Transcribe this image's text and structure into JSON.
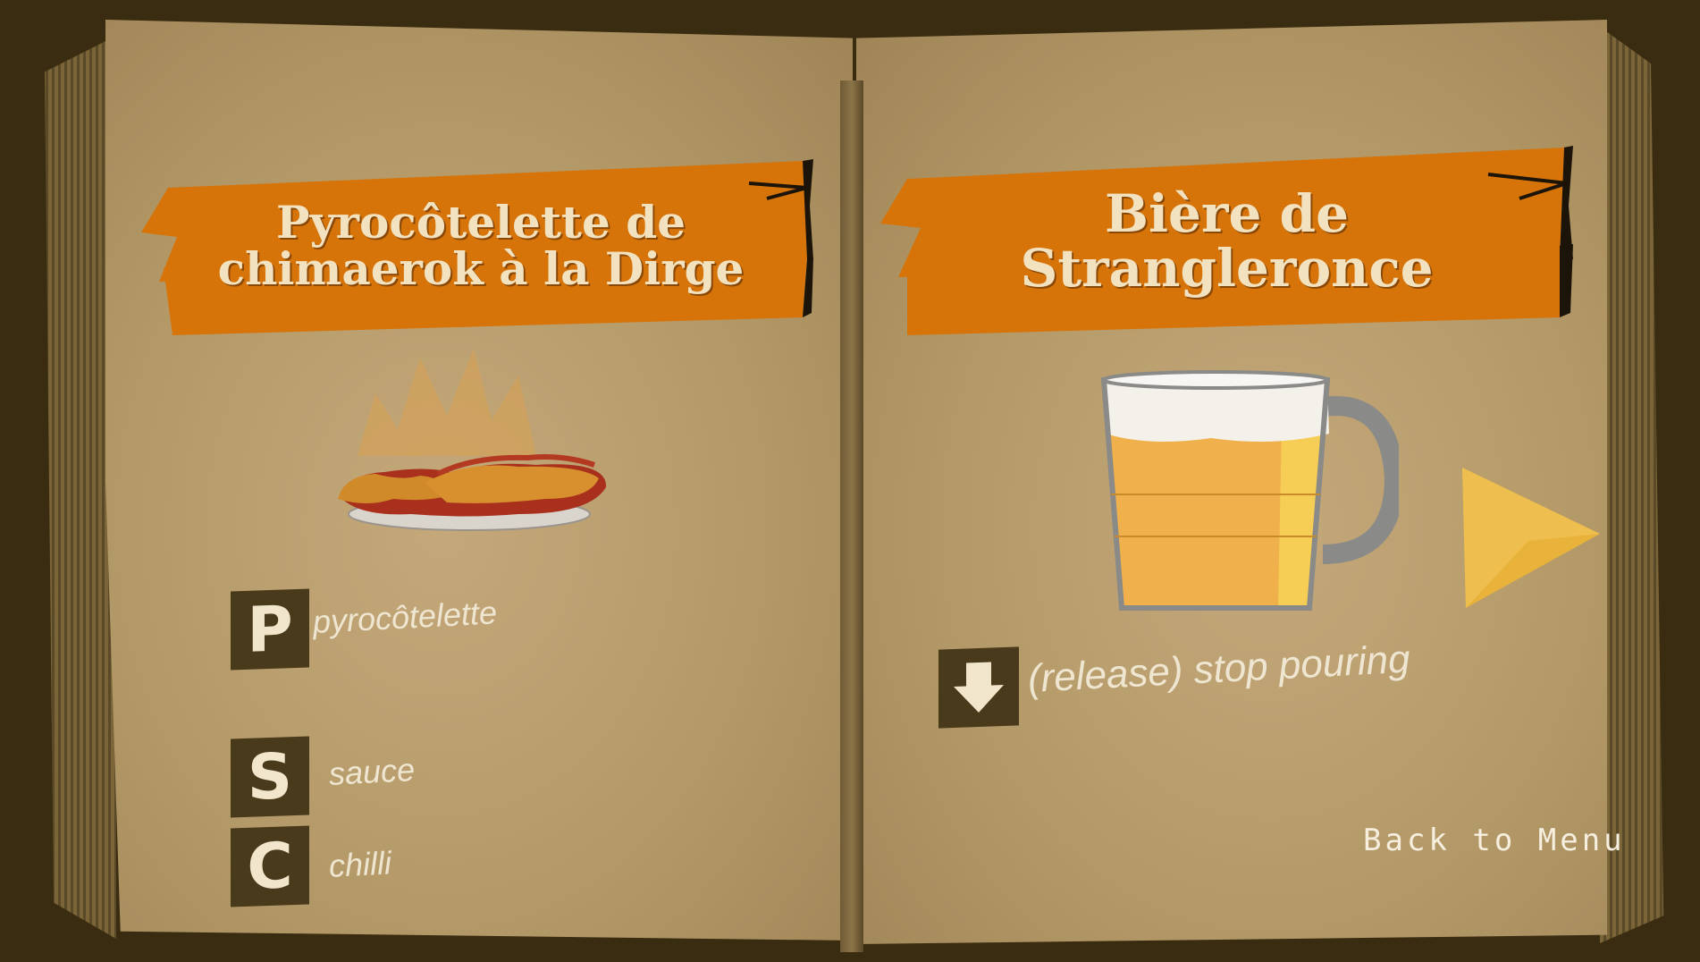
{
  "left_page": {
    "recipe_title": "Pyrocôtelette de\nchimaerok à la Dirge",
    "keys": [
      {
        "key": "P",
        "label": "pyrocôtelette"
      },
      {
        "key": "S",
        "label": "sauce"
      },
      {
        "key": "C",
        "label": "chilli"
      }
    ]
  },
  "right_page": {
    "recipe_title": "Bière de\nStrangleronce",
    "action": {
      "key_icon": "down-arrow-icon",
      "label": "(release) stop pouring"
    },
    "next_icon": "next-arrow-icon",
    "back_to_menu": "Back to Menu"
  },
  "colors": {
    "banner": "#d6740a",
    "banner_text": "#f3e2bf",
    "key_tile": "#4a3a1c",
    "page": "#b49968",
    "next_arrow": "#e9b23a"
  }
}
